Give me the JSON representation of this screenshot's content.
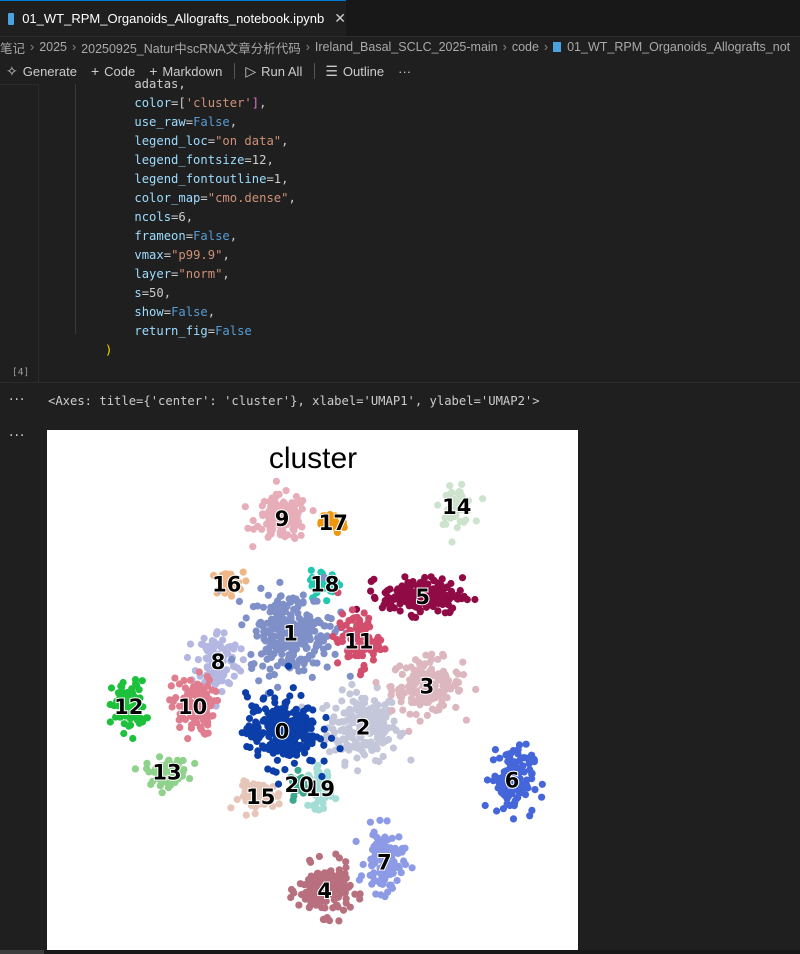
{
  "tab": {
    "title": "01_WT_RPM_Organoids_Allografts_notebook.ipynb",
    "close_glyph": "✕",
    "icon": "notebook-icon"
  },
  "breadcrumb": {
    "segments": [
      "笔记",
      "2025",
      "20250925_Natur中scRNA文章分析代码",
      "Ireland_Basal_SCLC_2025-main",
      "code",
      "01_WT_RPM_Organoids_Allografts_not"
    ],
    "separator": "›"
  },
  "toolbar": {
    "generate": "Generate",
    "code": "Code",
    "markdown": "Markdown",
    "run_all": "Run All",
    "outline": "Outline",
    "more": "···"
  },
  "code_lines": [
    "    adatas,",
    "    color=['cluster'],",
    "    use_raw=False,",
    "    legend_loc=\"on data\",",
    "    legend_fontsize=12,",
    "    legend_fontoutline=1,",
    "    color_map=\"cmo.dense\",",
    "    ncols=6,",
    "    frameon=False,",
    "    vmax=\"p99.9\",",
    "    layer=\"norm\",",
    "    s=50,",
    "    show=False,",
    "    return_fig=False",
    ")"
  ],
  "cell": {
    "exec_count": "[4]",
    "more_glyph": "···",
    "output_text": "<Axes: title={'center': 'cluster'}, xlabel='UMAP1', ylabel='UMAP2'>"
  },
  "chart_data": {
    "type": "scatter",
    "title": "cluster",
    "xlabel": "",
    "ylabel": "",
    "frame": false,
    "legend": "on data",
    "clusters": [
      {
        "label": "0",
        "color": "#0b3ea8",
        "center": [
          5.0,
          5.0
        ]
      },
      {
        "label": "1",
        "color": "#7f8fc7",
        "center": [
          5.2,
          7.4
        ]
      },
      {
        "label": "2",
        "color": "#c4c6da",
        "center": [
          6.9,
          5.1
        ]
      },
      {
        "label": "3",
        "color": "#dcb7bf",
        "center": [
          8.4,
          6.1
        ]
      },
      {
        "label": "4",
        "color": "#b86f7e",
        "center": [
          6.0,
          1.1
        ]
      },
      {
        "label": "5",
        "color": "#900b45",
        "center": [
          8.3,
          8.3
        ]
      },
      {
        "label": "6",
        "color": "#4566da",
        "center": [
          10.4,
          3.8
        ]
      },
      {
        "label": "7",
        "color": "#8d9be6",
        "center": [
          7.4,
          1.8
        ]
      },
      {
        "label": "8",
        "color": "#b3b7e2",
        "center": [
          3.5,
          6.7
        ]
      },
      {
        "label": "9",
        "color": "#e7aeb9",
        "center": [
          5.0,
          10.2
        ]
      },
      {
        "label": "10",
        "color": "#e07d8e",
        "center": [
          2.9,
          5.6
        ]
      },
      {
        "label": "11",
        "color": "#d34d6c",
        "center": [
          6.8,
          7.2
        ]
      },
      {
        "label": "12",
        "color": "#1ec13c",
        "center": [
          1.4,
          5.6
        ]
      },
      {
        "label": "13",
        "color": "#8fd28c",
        "center": [
          2.3,
          4.0
        ]
      },
      {
        "label": "14",
        "color": "#cde3cd",
        "center": [
          9.1,
          10.5
        ]
      },
      {
        "label": "15",
        "color": "#e6c6b8",
        "center": [
          4.5,
          3.4
        ]
      },
      {
        "label": "16",
        "color": "#efb687",
        "center": [
          3.7,
          8.6
        ]
      },
      {
        "label": "17",
        "color": "#ef960c",
        "center": [
          6.2,
          10.1
        ]
      },
      {
        "label": "18",
        "color": "#22c9b0",
        "center": [
          6.0,
          8.6
        ]
      },
      {
        "label": "19",
        "color": "#a4dcd6",
        "center": [
          5.9,
          3.6
        ]
      },
      {
        "label": "20",
        "color": "#3da88f",
        "center": [
          5.4,
          3.7
        ]
      }
    ]
  }
}
